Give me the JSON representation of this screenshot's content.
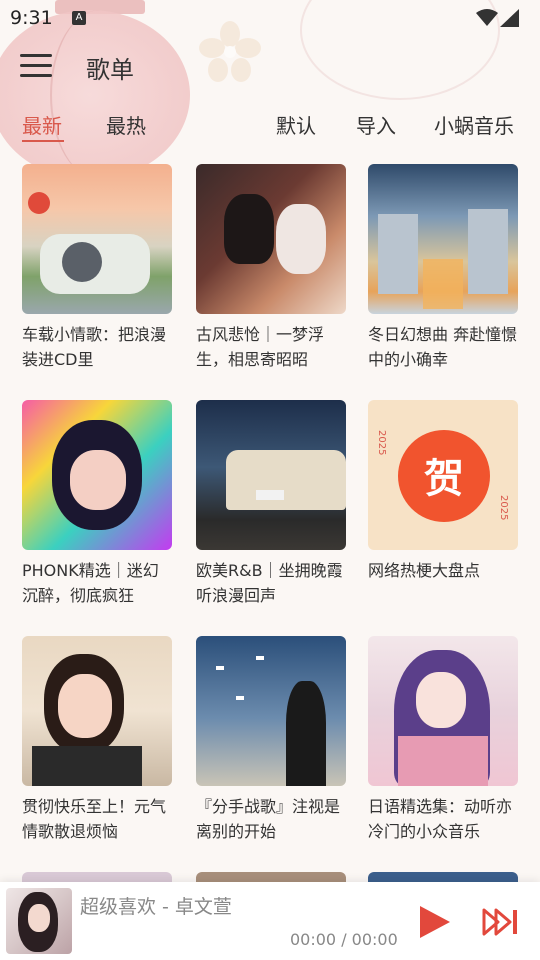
{
  "status": {
    "time": "9:31",
    "notif_letter": "A"
  },
  "header": {
    "title": "歌单"
  },
  "tabs": [
    "最新",
    "最热",
    "默认",
    "导入",
    "小蜗音乐"
  ],
  "playlists": [
    "车载小情歌：把浪漫装进CD里",
    "古风悲怆｜一梦浮生，相思寄昭昭",
    "冬日幻想曲 奔赴憧憬中的小确幸",
    "PHONK精选｜迷幻沉醉，彻底疯狂",
    "欧美R&B｜坐拥晚霞听浪漫回声",
    "网络热梗大盘点",
    "贯彻快乐至上！元气情歌散退烦恼",
    "『分手战歌』注视是离别的开始",
    "日语精选集：动听亦冷门的小众音乐"
  ],
  "cover_art": {
    "hexagram_label": "贺",
    "year_text": "2025"
  },
  "player": {
    "song": "超级喜欢 - 卓文萱",
    "time": "00:00 / 00:00"
  },
  "colors": {
    "accent": "#d9594c",
    "background": "#fbf7f4"
  }
}
